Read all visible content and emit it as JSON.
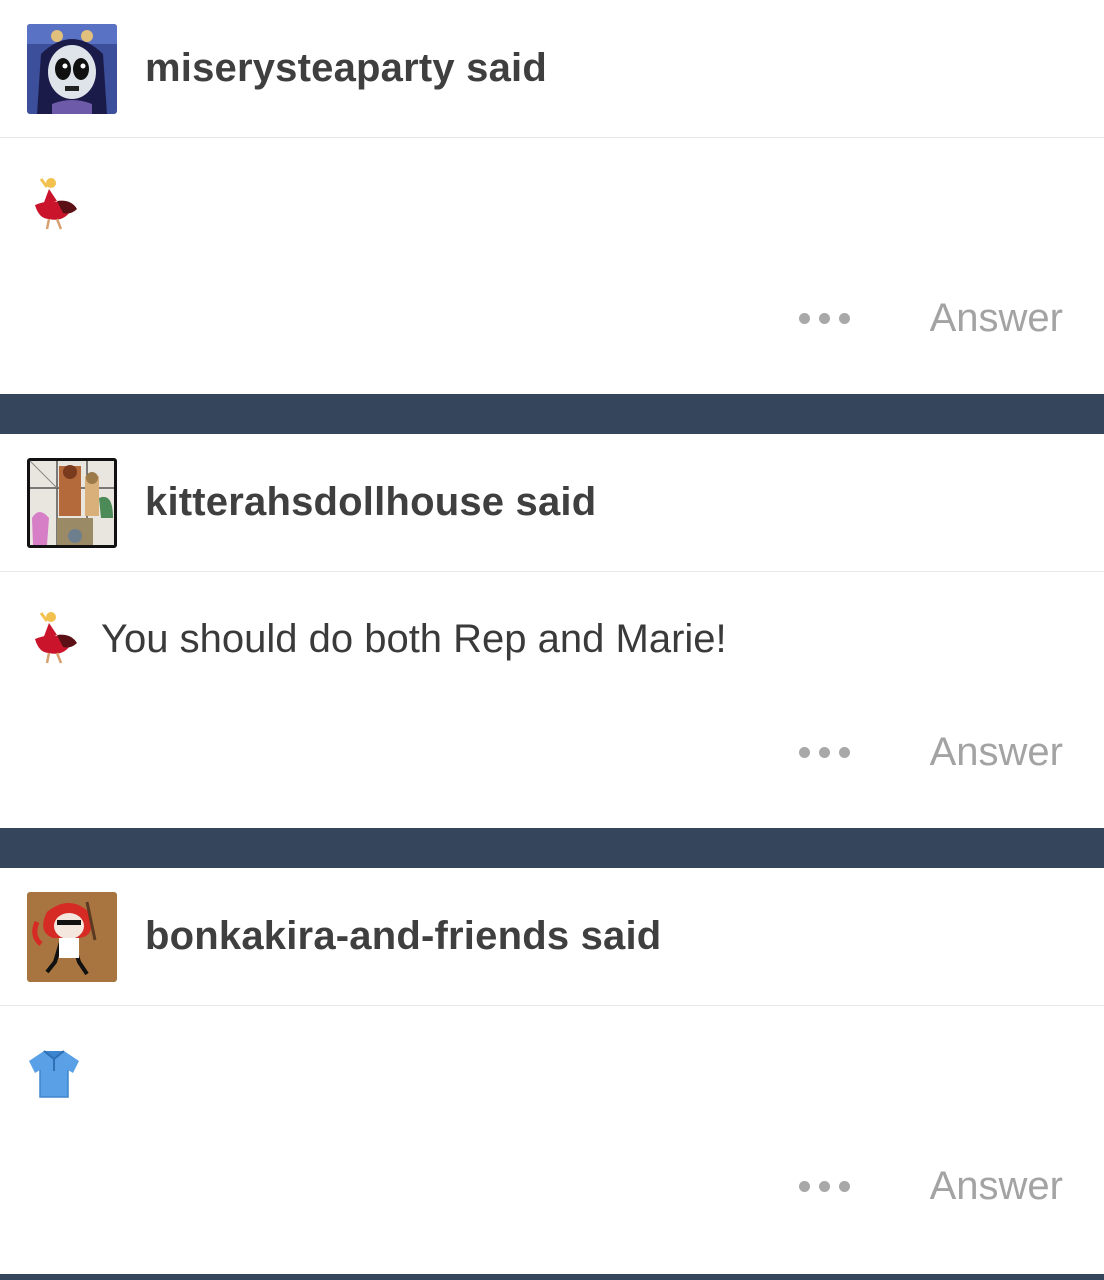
{
  "messages": [
    {
      "sender": "miserysteaparty said",
      "avatar": "skull-girl-avatar",
      "emoji": "dancer-emoji",
      "text": "",
      "answer_label": "Answer",
      "more_icon": "more-dots-icon"
    },
    {
      "sender": "kitterahsdollhouse said",
      "avatar": "dolls-collage-avatar",
      "emoji": "dancer-emoji",
      "text": "You should do both Rep and Marie!",
      "answer_label": "Answer",
      "more_icon": "more-dots-icon"
    },
    {
      "sender": "bonkakira-and-friends said",
      "avatar": "red-hair-girl-avatar",
      "emoji": "shirt-emoji",
      "text": "",
      "answer_label": "Answer",
      "more_icon": "more-dots-icon"
    }
  ],
  "colors": {
    "separator": "#35465c",
    "answer": "#a3a3a3",
    "sender": "#3f3f3f"
  }
}
